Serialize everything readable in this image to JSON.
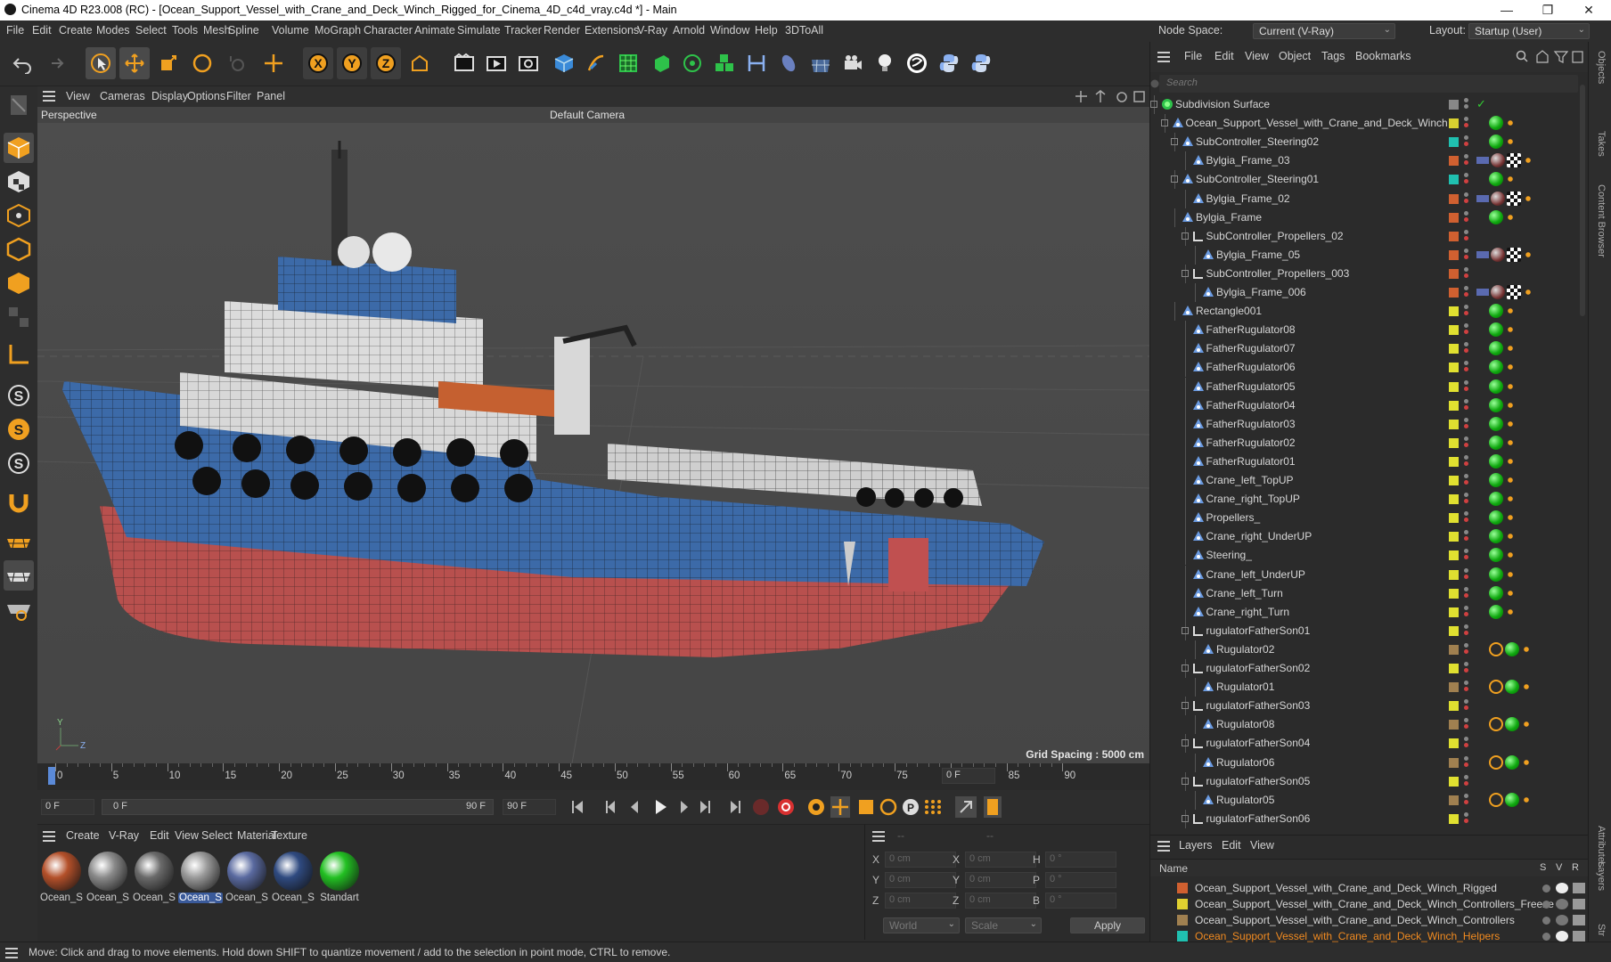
{
  "window": {
    "title": "Cinema 4D R23.008 (RC) - [Ocean_Support_Vessel_with_Crane_and_Deck_Winch_Rigged_for_Cinema_4D_c4d_vray.c4d *] - Main",
    "minimize": "—",
    "maximize": "❐",
    "close": "✕"
  },
  "menu": [
    "File",
    "Edit",
    "Create",
    "Modes",
    "Select",
    "Tools",
    "Mesh",
    "Spline",
    "Volume",
    "MoGraph",
    "Character",
    "Animate",
    "Simulate",
    "Tracker",
    "Render",
    "Extensions",
    "V-Ray",
    "Arnold",
    "Window",
    "Help",
    "3DToAll"
  ],
  "node_space": {
    "label": "Node Space:",
    "value": "Current (V-Ray)"
  },
  "layout": {
    "label": "Layout:",
    "value": "Startup (User)"
  },
  "viewport": {
    "menu": [
      "View",
      "Cameras",
      "Display",
      "Options",
      "Filter",
      "Panel"
    ],
    "name": "Perspective",
    "camera": "Default Camera",
    "grid_spacing": "Grid Spacing : 5000 cm",
    "axis_y": "Y",
    "axis_z": "Z"
  },
  "timeline": {
    "ticks": [
      "0",
      "5",
      "10",
      "15",
      "20",
      "25",
      "30",
      "35",
      "40",
      "45",
      "50",
      "55",
      "60",
      "65",
      "70",
      "75",
      "80",
      "85",
      "90"
    ],
    "current_frame": "0 F"
  },
  "transport": {
    "start": "0 F",
    "range_start": "0 F",
    "range_end": "90 F",
    "end": "90 F"
  },
  "materials": {
    "menu": [
      "Create",
      "V-Ray",
      "Edit",
      "View",
      "Select",
      "Material",
      "Texture"
    ],
    "items": [
      {
        "label": "Ocean_S",
        "color": "#b4502a"
      },
      {
        "label": "Ocean_S",
        "color": "#8a8a8a"
      },
      {
        "label": "Ocean_S",
        "color": "#6a6a6a"
      },
      {
        "label": "Ocean_S",
        "color": "#9a9a9a",
        "selected": true
      },
      {
        "label": "Ocean_S",
        "color": "#5a6aa0"
      },
      {
        "label": "Ocean_S",
        "color": "#2f4a80"
      },
      {
        "label": "Standart",
        "color": "#22c022"
      }
    ]
  },
  "coords": {
    "rows": [
      {
        "a": "X",
        "av": "0 cm",
        "b": "X",
        "bv": "0 cm",
        "c": "H",
        "cv": "0 °"
      },
      {
        "a": "Y",
        "av": "0 cm",
        "b": "Y",
        "bv": "0 cm",
        "c": "P",
        "cv": "0 °"
      },
      {
        "a": "Z",
        "av": "0 cm",
        "b": "Z",
        "bv": "0 cm",
        "c": "B",
        "cv": "0 °"
      }
    ],
    "world": "World",
    "scale": "Scale",
    "apply": "Apply",
    "dash1": "--",
    "dash2": "--"
  },
  "status": "Move: Click and drag to move elements. Hold down SHIFT to quantize movement / add to the selection in point mode, CTRL to remove.",
  "objects": {
    "menu": [
      "File",
      "Edit",
      "View",
      "Object",
      "Tags",
      "Bookmarks"
    ],
    "search_placeholder": "Search",
    "rows": [
      {
        "name": "Subdivision Surface",
        "indent": 0,
        "color": "#888888",
        "kind": "sub"
      },
      {
        "name": "Ocean_Support_Vessel_with_Crane_and_Deck_Winch",
        "indent": 1,
        "color": "#d8d030",
        "kind": "null"
      },
      {
        "name": "SubController_Steering02",
        "indent": 2,
        "color": "#20c0b0",
        "kind": "null"
      },
      {
        "name": "Bylgia_Frame_03",
        "indent": 3,
        "color": "#d06030",
        "kind": "mesh"
      },
      {
        "name": "SubController_Steering01",
        "indent": 2,
        "color": "#20c0b0",
        "kind": "null"
      },
      {
        "name": "Bylgia_Frame_02",
        "indent": 3,
        "color": "#d06030",
        "kind": "mesh"
      },
      {
        "name": "Bylgia_Frame",
        "indent": 2,
        "color": "#d06030",
        "kind": "mesh"
      },
      {
        "name": "SubController_Propellers_02",
        "indent": 3,
        "color": "#d06030",
        "kind": "null"
      },
      {
        "name": "Bylgia_Frame_05",
        "indent": 4,
        "color": "#d06030",
        "kind": "mesh"
      },
      {
        "name": "SubController_Propellers_003",
        "indent": 3,
        "color": "#d06030",
        "kind": "null"
      },
      {
        "name": "Bylgia_Frame_006",
        "indent": 4,
        "color": "#d06030",
        "kind": "mesh"
      },
      {
        "name": "Rectangle001",
        "indent": 2,
        "color": "#e0e030",
        "kind": "mesh"
      },
      {
        "name": "FatherRugulator08",
        "indent": 3,
        "color": "#e0e030",
        "kind": "mesh"
      },
      {
        "name": "FatherRugulator07",
        "indent": 3,
        "color": "#e0e030",
        "kind": "mesh"
      },
      {
        "name": "FatherRugulator06",
        "indent": 3,
        "color": "#e0e030",
        "kind": "mesh"
      },
      {
        "name": "FatherRugulator05",
        "indent": 3,
        "color": "#e0e030",
        "kind": "mesh"
      },
      {
        "name": "FatherRugulator04",
        "indent": 3,
        "color": "#e0e030",
        "kind": "mesh"
      },
      {
        "name": "FatherRugulator03",
        "indent": 3,
        "color": "#e0e030",
        "kind": "mesh"
      },
      {
        "name": "FatherRugulator02",
        "indent": 3,
        "color": "#e0e030",
        "kind": "mesh"
      },
      {
        "name": "FatherRugulator01",
        "indent": 3,
        "color": "#e0e030",
        "kind": "mesh"
      },
      {
        "name": "Crane_left_TopUP",
        "indent": 3,
        "color": "#e0e030",
        "kind": "mesh"
      },
      {
        "name": "Crane_right_TopUP",
        "indent": 3,
        "color": "#e0e030",
        "kind": "mesh"
      },
      {
        "name": "Propellers_",
        "indent": 3,
        "color": "#e0e030",
        "kind": "mesh"
      },
      {
        "name": "Crane_right_UnderUP",
        "indent": 3,
        "color": "#e0e030",
        "kind": "mesh"
      },
      {
        "name": "Steering_",
        "indent": 3,
        "color": "#e0e030",
        "kind": "mesh"
      },
      {
        "name": "Crane_left_UnderUP",
        "indent": 3,
        "color": "#e0e030",
        "kind": "mesh"
      },
      {
        "name": "Crane_left_Turn",
        "indent": 3,
        "color": "#e0e030",
        "kind": "mesh"
      },
      {
        "name": "Crane_right_Turn",
        "indent": 3,
        "color": "#e0e030",
        "kind": "mesh"
      },
      {
        "name": "rugulatorFatherSon01",
        "indent": 3,
        "color": "#e0e030",
        "kind": "null"
      },
      {
        "name": "Rugulator02",
        "indent": 4,
        "color": "#a08050",
        "kind": "mesh"
      },
      {
        "name": "rugulatorFatherSon02",
        "indent": 3,
        "color": "#e0e030",
        "kind": "null"
      },
      {
        "name": "Rugulator01",
        "indent": 4,
        "color": "#a08050",
        "kind": "mesh"
      },
      {
        "name": "rugulatorFatherSon03",
        "indent": 3,
        "color": "#e0e030",
        "kind": "null"
      },
      {
        "name": "Rugulator08",
        "indent": 4,
        "color": "#a08050",
        "kind": "mesh"
      },
      {
        "name": "rugulatorFatherSon04",
        "indent": 3,
        "color": "#e0e030",
        "kind": "null"
      },
      {
        "name": "Rugulator06",
        "indent": 4,
        "color": "#a08050",
        "kind": "mesh"
      },
      {
        "name": "rugulatorFatherSon05",
        "indent": 3,
        "color": "#e0e030",
        "kind": "null"
      },
      {
        "name": "Rugulator05",
        "indent": 4,
        "color": "#a08050",
        "kind": "mesh"
      },
      {
        "name": "rugulatorFatherSon06",
        "indent": 3,
        "color": "#e0e030",
        "kind": "null"
      }
    ]
  },
  "layers": {
    "menu": [
      "Layers",
      "Edit",
      "View"
    ],
    "col_name": "Name",
    "col_s": "S",
    "col_v": "V",
    "col_r": "R",
    "rows": [
      {
        "name": "Ocean_Support_Vessel_with_Crane_and_Deck_Winch_Rigged",
        "color": "#d06030"
      },
      {
        "name": "Ocean_Support_Vessel_with_Crane_and_Deck_Winch_Controllers_Freeze",
        "color": "#e0d030"
      },
      {
        "name": "Ocean_Support_Vessel_with_Crane_and_Deck_Winch_Controllers",
        "color": "#a08050"
      },
      {
        "name": "Ocean_Support_Vessel_with_Crane_and_Deck_Winch_Helpers",
        "color": "#20c0b0",
        "highlight": true
      }
    ]
  },
  "side_tabs": [
    "Objects",
    "Takes",
    "Content Browser",
    "Attributes",
    "Layers",
    "Str"
  ]
}
